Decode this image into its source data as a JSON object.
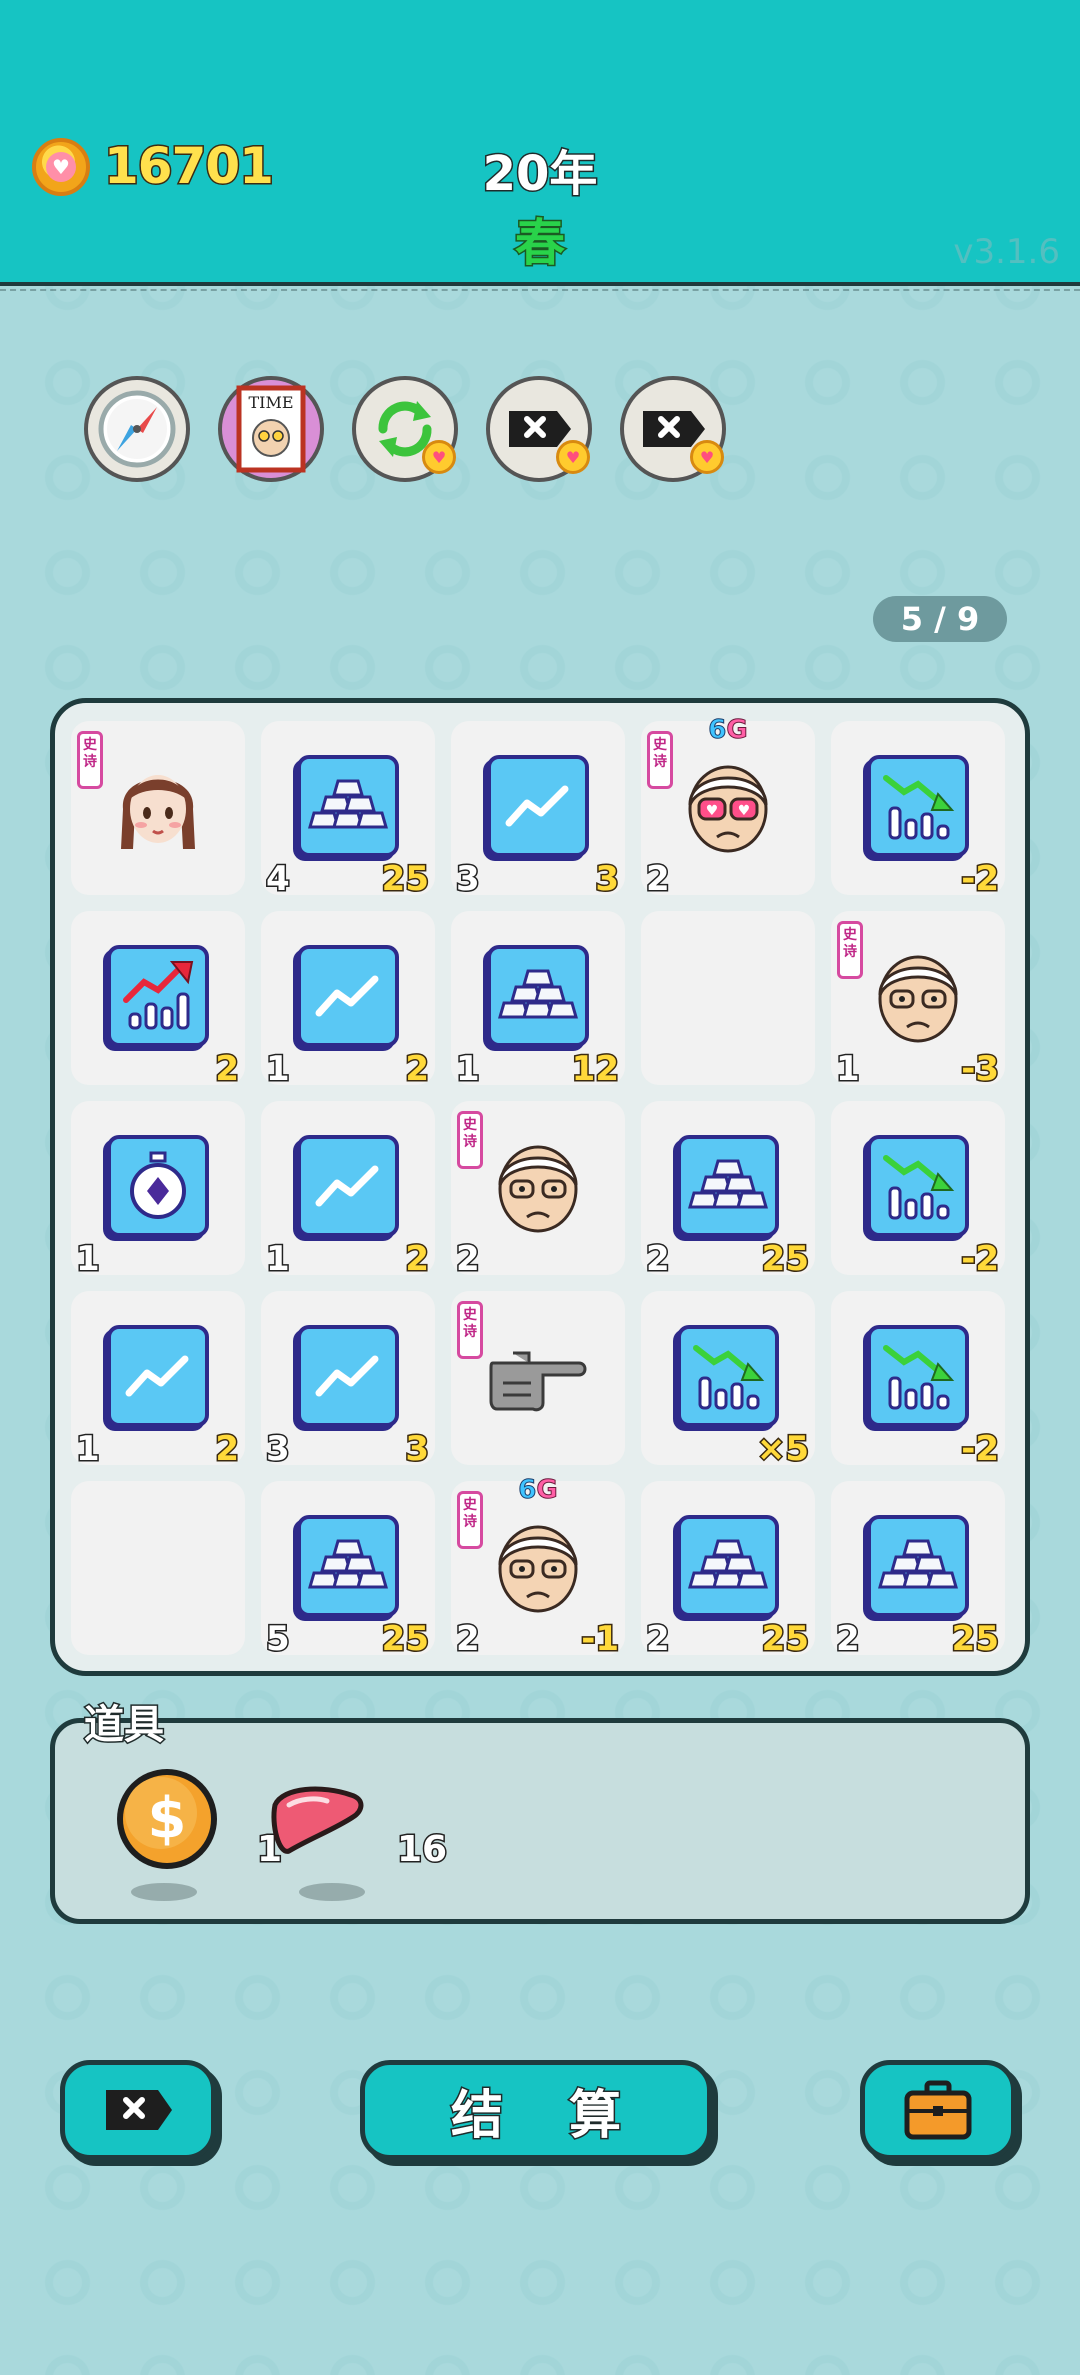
{
  "header": {
    "coins": "16701",
    "year": "20年",
    "season": "春",
    "version": "v3.1.6"
  },
  "toolbar": [
    {
      "name": "compass-button",
      "icon": "compass-icon"
    },
    {
      "name": "time-magazine-button",
      "icon": "time-magazine-icon",
      "label": "TIME"
    },
    {
      "name": "refresh-button",
      "icon": "refresh-icon"
    },
    {
      "name": "remove-button-1",
      "icon": "remove-icon"
    },
    {
      "name": "remove-button-2",
      "icon": "remove-icon"
    }
  ],
  "page_indicator": "5 / 9",
  "board": [
    {
      "icon": "girl-portrait-icon",
      "tag": "史诗",
      "count": "",
      "value": ""
    },
    {
      "icon": "gold-bars-icon",
      "count": "4",
      "value": "25"
    },
    {
      "icon": "trend-up-icon",
      "count": "3",
      "value": "3"
    },
    {
      "icon": "old-man-heart-eyes-icon",
      "tag": "史诗",
      "badge": [
        "6",
        "G"
      ],
      "count": "2",
      "value": ""
    },
    {
      "icon": "chart-down-icon",
      "count": "",
      "value": "-2"
    },
    {
      "icon": "chart-up-icon",
      "count": "",
      "value": "2"
    },
    {
      "icon": "trend-up-icon",
      "count": "1",
      "value": "2"
    },
    {
      "icon": "gold-bars-icon",
      "count": "1",
      "value": "12"
    },
    {
      "icon": "empty",
      "count": "",
      "value": ""
    },
    {
      "icon": "old-man-sad-icon",
      "tag": "史诗",
      "count": "1",
      "value": "-3"
    },
    {
      "icon": "stopwatch-icon",
      "count": "1",
      "value": ""
    },
    {
      "icon": "trend-up-icon",
      "count": "1",
      "value": "2"
    },
    {
      "icon": "old-man-sad-icon",
      "tag": "史诗",
      "count": "2",
      "value": ""
    },
    {
      "icon": "gold-bars-icon",
      "count": "2",
      "value": "25"
    },
    {
      "icon": "chart-down-icon",
      "count": "",
      "value": "-2"
    },
    {
      "icon": "trend-up-icon",
      "count": "1",
      "value": "2"
    },
    {
      "icon": "trend-up-icon",
      "count": "3",
      "value": "3"
    },
    {
      "icon": "pointing-hand-icon",
      "tag": "史诗",
      "count": "",
      "value": ""
    },
    {
      "icon": "chart-down-icon",
      "count": "",
      "value": "×5"
    },
    {
      "icon": "chart-down-icon",
      "count": "",
      "value": "-2"
    },
    {
      "icon": "empty",
      "count": "",
      "value": ""
    },
    {
      "icon": "gold-bars-icon",
      "count": "5",
      "value": "25"
    },
    {
      "icon": "old-man-sad-icon",
      "tag": "史诗",
      "badge": [
        "6",
        "G"
      ],
      "count": "2",
      "value": "-1"
    },
    {
      "icon": "gold-bars-icon",
      "count": "2",
      "value": "25"
    },
    {
      "icon": "gold-bars-icon",
      "count": "2",
      "value": "25"
    }
  ],
  "items": {
    "label": "道具",
    "list": [
      {
        "icon": "dollar-coin-icon",
        "qty": "1"
      },
      {
        "icon": "liver-icon",
        "qty": "16"
      }
    ]
  },
  "bottom": {
    "settle_label": "结 算"
  }
}
